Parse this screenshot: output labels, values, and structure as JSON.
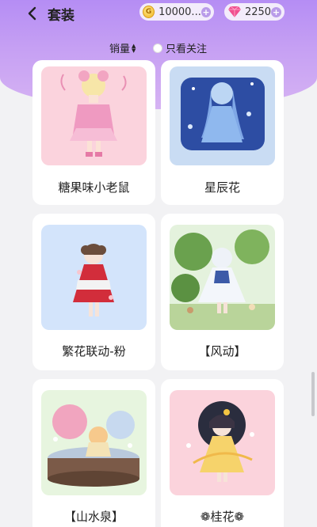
{
  "header": {
    "title": "套装",
    "gold_amount": "10000...",
    "gem_amount": "2250",
    "back_icon": "chevron-left-icon",
    "gold_icon": "gold-coin-icon",
    "gem_icon": "pink-gem-icon",
    "coin_glyph": "G"
  },
  "filter": {
    "sort_label": "销量",
    "follow_label": "只看关注"
  },
  "items": [
    {
      "name": "糖果味小老鼠",
      "bg": "#fbd3dd"
    },
    {
      "name": "星辰花",
      "bg": "#c9dcf3"
    },
    {
      "name": "繁花联动-粉",
      "bg": "#d3e4fb"
    },
    {
      "name": "【风动】",
      "bg": "#e4f2dd"
    },
    {
      "name": "【山水泉】",
      "bg": "#e7f5df"
    },
    {
      "name": "❁桂花❁",
      "bg": "#fbd3dc"
    }
  ],
  "colors": {
    "accent": "#b58df4",
    "card_bg": "#ffffff"
  }
}
